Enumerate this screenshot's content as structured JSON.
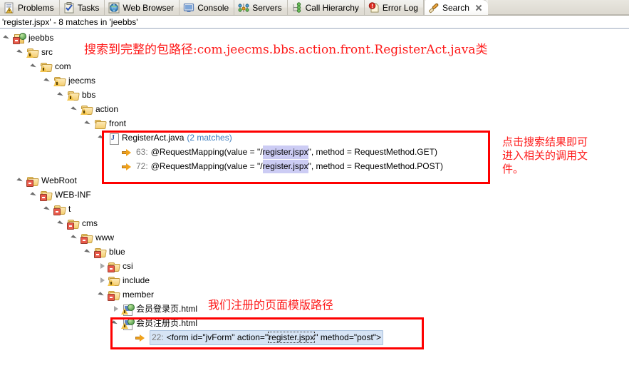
{
  "window": {
    "tabs": [
      {
        "label": "Problems",
        "icon": "problems-icon",
        "active": false
      },
      {
        "label": "Tasks",
        "icon": "tasks-icon",
        "active": false
      },
      {
        "label": "Web Browser",
        "icon": "web-browser-icon",
        "active": false
      },
      {
        "label": "Console",
        "icon": "console-icon",
        "active": false
      },
      {
        "label": "Servers",
        "icon": "servers-icon",
        "active": false
      },
      {
        "label": "Call Hierarchy",
        "icon": "call-hierarchy-icon",
        "active": false
      },
      {
        "label": "Error Log",
        "icon": "error-log-icon",
        "active": false
      },
      {
        "label": "Search",
        "icon": "search-icon",
        "active": true
      }
    ],
    "status_line": "'register.jspx' - 8 matches in 'jeebbs'"
  },
  "tree": {
    "nodes": [
      {
        "id": "jeebbs",
        "label": "jeebbs",
        "kind": "project",
        "state": "open",
        "depth": 0
      },
      {
        "id": "src",
        "label": "src",
        "kind": "package-warn",
        "state": "open",
        "depth": 1
      },
      {
        "id": "com",
        "label": "com",
        "kind": "package-warn",
        "state": "open",
        "depth": 2
      },
      {
        "id": "jeecms",
        "label": "jeecms",
        "kind": "package-warn",
        "state": "open",
        "depth": 3
      },
      {
        "id": "bbs",
        "label": "bbs",
        "kind": "package-warn",
        "state": "open",
        "depth": 4
      },
      {
        "id": "action",
        "label": "action",
        "kind": "package-warn",
        "state": "open",
        "depth": 5
      },
      {
        "id": "front",
        "label": "front",
        "kind": "package",
        "state": "open",
        "depth": 6
      },
      {
        "id": "registeract",
        "label": "RegisterAct.java",
        "kind": "java",
        "state": "open",
        "depth": 7,
        "badge": "(2 matches)"
      },
      {
        "id": "match63",
        "label": "",
        "kind": "match",
        "depth": 8,
        "line": "63:",
        "pre": "@RequestMapping(value = \"/",
        "hit": "register.jspx",
        "post": "\", method = RequestMethod.GET)"
      },
      {
        "id": "match72",
        "label": "",
        "kind": "match",
        "depth": 8,
        "line": "72:",
        "pre": "@RequestMapping(value = \"/",
        "hit": "register.jspx",
        "post": "\", method = RequestMethod.POST)"
      },
      {
        "id": "webroot",
        "label": "WebRoot",
        "kind": "package-err",
        "state": "open",
        "depth": 1
      },
      {
        "id": "webinf",
        "label": "WEB-INF",
        "kind": "package-err",
        "state": "open",
        "depth": 2
      },
      {
        "id": "t",
        "label": "t",
        "kind": "package-err",
        "state": "open",
        "depth": 3
      },
      {
        "id": "cms",
        "label": "cms",
        "kind": "package-err",
        "state": "open",
        "depth": 4
      },
      {
        "id": "www",
        "label": "www",
        "kind": "package-err",
        "state": "open",
        "depth": 5
      },
      {
        "id": "blue",
        "label": "blue",
        "kind": "package-err",
        "state": "open",
        "depth": 6
      },
      {
        "id": "csi",
        "label": "csi",
        "kind": "package-err",
        "state": "closed",
        "depth": 7
      },
      {
        "id": "include",
        "label": "include",
        "kind": "package-warn",
        "state": "closed",
        "depth": 7
      },
      {
        "id": "member",
        "label": "member",
        "kind": "package-err",
        "state": "open",
        "depth": 7
      },
      {
        "id": "login-html",
        "label": "会员登录页.html",
        "kind": "html",
        "state": "closed",
        "depth": 8
      },
      {
        "id": "reg-html",
        "label": "会员注册页.html",
        "kind": "html",
        "state": "open",
        "depth": 8
      },
      {
        "id": "match22",
        "label": "",
        "kind": "match-selected",
        "depth": 9,
        "line": "22:",
        "pre": "<form id=\"jvForm\" action=\"",
        "hit": "register.jspx",
        "post": "\" method=\"post\">"
      }
    ]
  },
  "annotations": {
    "top": "搜索到完整的包路径:com.jeecms.bbs.action.front.RegisterAct.java类",
    "right": "点击搜索结果即可\n进入相关的调用文\n件。",
    "bottom": "我们注册的页面模版路径"
  },
  "colors": {
    "annotation_red": "#fe1a1a",
    "box_red": "#fe0000",
    "match_count_blue": "#3a7bbd",
    "highlight_lavender": "#ccccf4",
    "selection_blue": "#d6e4f5"
  }
}
